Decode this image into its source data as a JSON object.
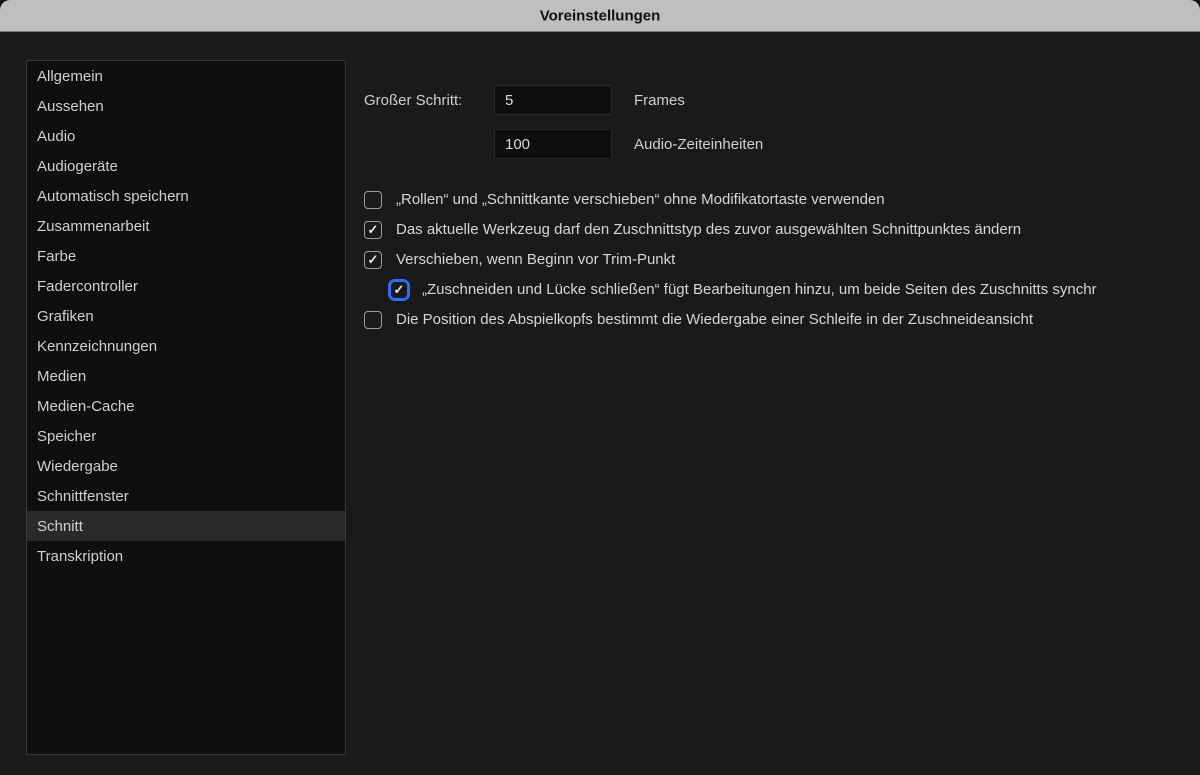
{
  "window": {
    "title": "Voreinstellungen"
  },
  "sidebar": {
    "items": [
      {
        "label": "Allgemein"
      },
      {
        "label": "Aussehen"
      },
      {
        "label": "Audio"
      },
      {
        "label": "Audiogeräte"
      },
      {
        "label": "Automatisch speichern"
      },
      {
        "label": "Zusammenarbeit"
      },
      {
        "label": "Farbe"
      },
      {
        "label": "Fadercontroller"
      },
      {
        "label": "Grafiken"
      },
      {
        "label": "Kennzeichnungen"
      },
      {
        "label": "Medien"
      },
      {
        "label": "Medien-Cache"
      },
      {
        "label": "Speicher"
      },
      {
        "label": "Wiedergabe"
      },
      {
        "label": "Schnittfenster"
      },
      {
        "label": "Schnitt"
      },
      {
        "label": "Transkription"
      }
    ],
    "selected_index": 15
  },
  "content": {
    "large_step_label": "Großer Schritt:",
    "frames_value": "5",
    "frames_unit": "Frames",
    "audio_units_value": "100",
    "audio_units_unit": "Audio-Zeiteinheiten",
    "options": [
      {
        "label": "„Rollen“ und „Schnittkante verschieben“ ohne Modifikatortaste verwenden",
        "checked": false,
        "indent": false,
        "focused": false
      },
      {
        "label": "Das aktuelle Werkzeug darf den Zuschnittstyp des zuvor ausgewählten Schnittpunktes ändern",
        "checked": true,
        "indent": false,
        "focused": false
      },
      {
        "label": "Verschieben, wenn Beginn vor Trim-Punkt",
        "checked": true,
        "indent": false,
        "focused": false
      },
      {
        "label": "„Zuschneiden und Lücke schließen“ fügt Bearbeitungen hinzu, um beide Seiten des Zuschnitts synchr",
        "checked": true,
        "indent": true,
        "focused": true
      },
      {
        "label": "Die Position des Abspielkopfs bestimmt die Wiedergabe einer Schleife in der Zuschneideansicht",
        "checked": false,
        "indent": false,
        "focused": false
      }
    ]
  }
}
